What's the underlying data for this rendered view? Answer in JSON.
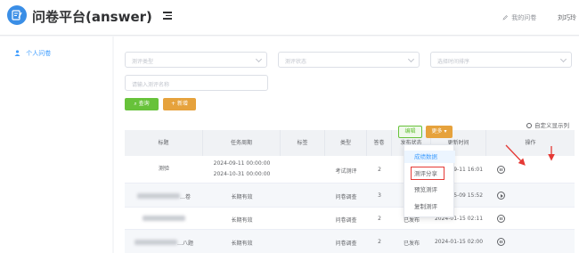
{
  "app": {
    "title": "问卷平台(answer)"
  },
  "header": {
    "my_questionnaire": "我的问卷",
    "user_name": "刘巧玲"
  },
  "sidebar": {
    "items": [
      {
        "label": "个人问卷",
        "active": true
      }
    ]
  },
  "filters": {
    "type_placeholder": "测评类型",
    "status_placeholder": "测评状态",
    "time_placeholder": "选择时间排序",
    "name_placeholder": "请输入测评名称",
    "search_label": "查询",
    "add_label": "新增"
  },
  "custom_columns_label": "自定义显示列",
  "table": {
    "headers": [
      "标题",
      "任务周期",
      "标签",
      "类型",
      "答卷",
      "发布状态",
      "更新时间",
      "操作"
    ],
    "rows": [
      {
        "title": "测验",
        "title_blurred": false,
        "period_start": "2024-09-11 00:00:00",
        "period_end": "2024-10-31 00:00:00",
        "period": "",
        "tag": "",
        "type": "考试测评",
        "answers": "2",
        "status": "已发布",
        "updated": "2024-09-11 16:01",
        "toggle": "pause"
      },
      {
        "title": "",
        "title_blurred": true,
        "title_visible_part": "…卷",
        "period": "长期有效",
        "tag": "",
        "type": "问卷调查",
        "answers": "3",
        "status": "未发布",
        "updated": "2024-05-09 15:52",
        "toggle": "play"
      },
      {
        "title": "",
        "title_blurred": true,
        "title_visible_part": "",
        "period": "长期有效",
        "tag": "",
        "type": "问卷调查",
        "answers": "2",
        "status": "已发布",
        "updated": "2024-01-15 02:11",
        "toggle": "pause"
      },
      {
        "title": "",
        "title_blurred": true,
        "title_visible_part": "…八题",
        "period": "长期有效",
        "tag": "",
        "type": "问卷调查",
        "answers": "2",
        "status": "已发布",
        "updated": "2024-01-15 02:00",
        "toggle": "pause"
      }
    ],
    "row_actions": {
      "edit_label": "编辑",
      "more_label": "更多"
    }
  },
  "more_menu": {
    "items": [
      "成绩数据",
      "测评分享",
      "预览测评",
      "复制测评"
    ],
    "active_index": 0,
    "highlighted_index": 1
  },
  "colors": {
    "primary": "#409eff",
    "success": "#67c23a",
    "warning": "#e6a23c",
    "annotation": "#e53935",
    "logo": "#3a8ee6"
  },
  "icons": {
    "logo": "edit-document-icon",
    "menu": "menu-fold-icon",
    "my_questionnaire": "pencil-icon",
    "sidebar_user": "user-icon",
    "search": "search-icon",
    "add": "plus-icon",
    "custom_cols": "gear-icon"
  }
}
